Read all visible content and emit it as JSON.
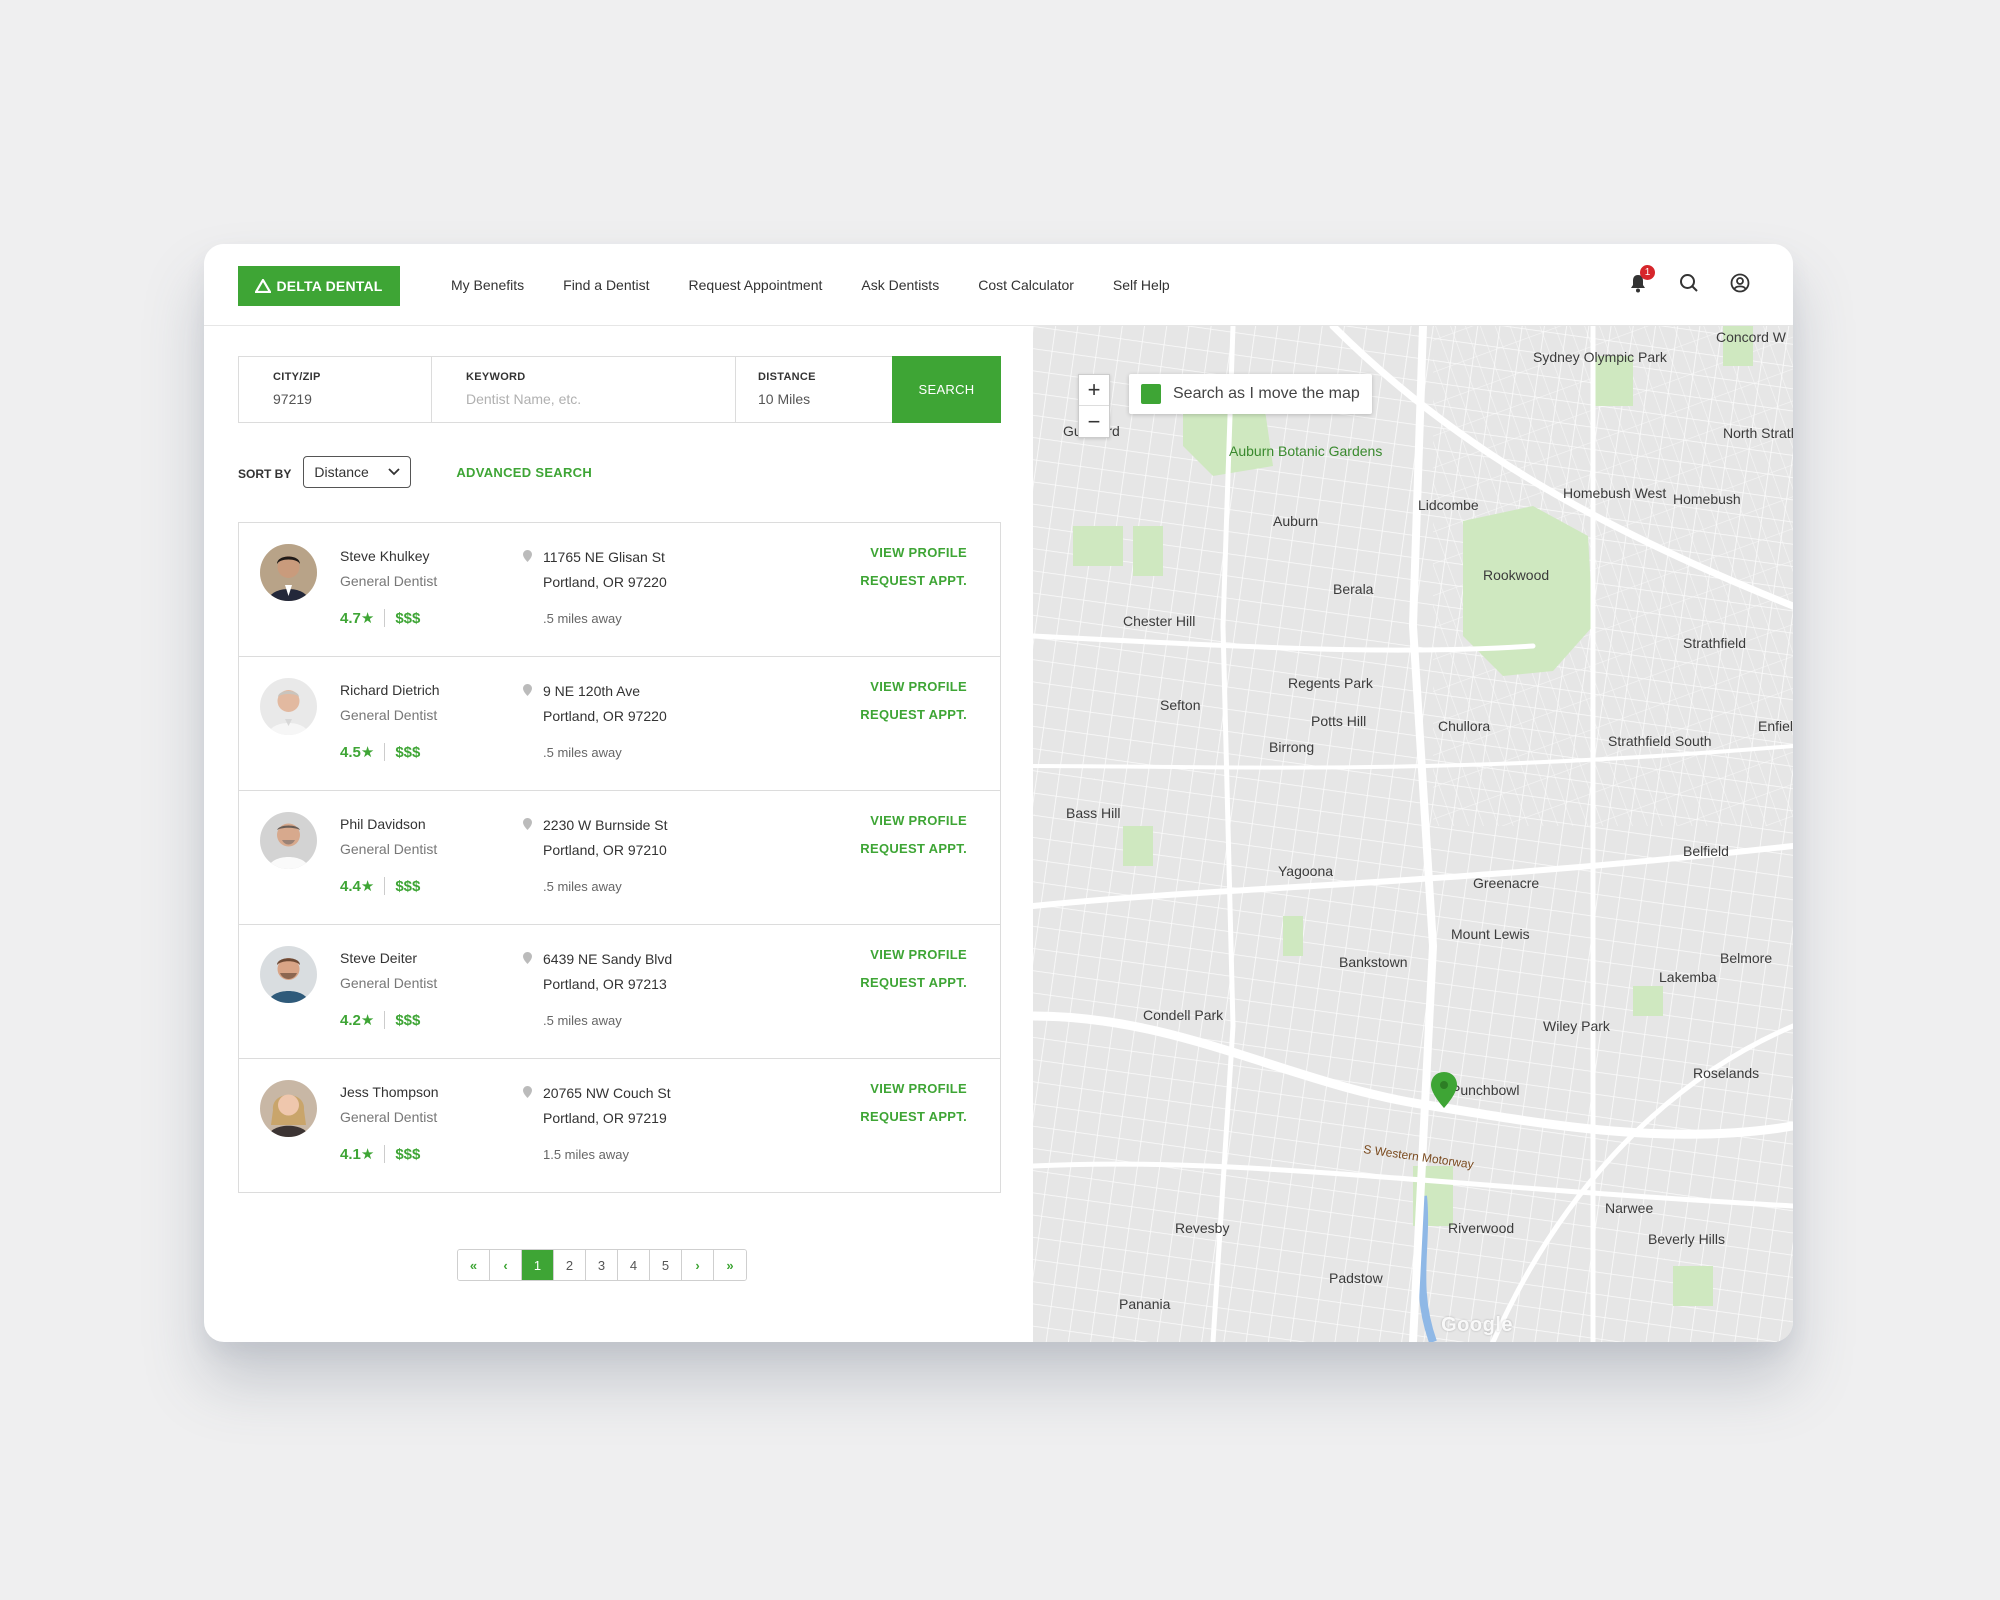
{
  "brand": {
    "logo_text": "DELTA DENTAL",
    "accent": "#3ea535"
  },
  "nav": [
    "My Benefits",
    "Find a Dentist",
    "Request Appointment",
    "Ask Dentists",
    "Cost Calculator",
    "Self Help"
  ],
  "header_icons": {
    "notifications": "bell-icon",
    "notification_count": "1",
    "search": "search-icon",
    "account": "user-icon"
  },
  "search": {
    "city_label": "CITY/ZIP",
    "city_value": "97219",
    "keyword_label": "KEYWORD",
    "keyword_placeholder": "Dentist Name, etc.",
    "distance_label": "DISTANCE",
    "distance_value": "10 Miles",
    "button": "SEARCH"
  },
  "sort": {
    "label": "SORT BY",
    "selected": "Distance",
    "advanced": "ADVANCED SEARCH"
  },
  "dentists": [
    {
      "name": "Steve Khulkey",
      "specialty": "General Dentist",
      "rating": "4.7",
      "cost": "$$$",
      "address1": "11765 NE Glisan St",
      "address2": "Portland, OR 97220",
      "distance": ".5 miles away",
      "view": "VIEW PROFILE",
      "request": "REQUEST APPT."
    },
    {
      "name": "Richard Dietrich",
      "specialty": "General Dentist",
      "rating": "4.5",
      "cost": "$$$",
      "address1": "9 NE 120th Ave",
      "address2": "Portland, OR 97220",
      "distance": ".5 miles away",
      "view": "VIEW PROFILE",
      "request": "REQUEST APPT."
    },
    {
      "name": "Phil Davidson",
      "specialty": "General Dentist",
      "rating": "4.4",
      "cost": "$$$",
      "address1": "2230 W Burnside St",
      "address2": "Portland, OR 97210",
      "distance": ".5 miles away",
      "view": "VIEW PROFILE",
      "request": "REQUEST APPT."
    },
    {
      "name": "Steve Deiter",
      "specialty": "General Dentist",
      "rating": "4.2",
      "cost": "$$$",
      "address1": "6439 NE Sandy Blvd",
      "address2": "Portland, OR 97213",
      "distance": ".5 miles away",
      "view": "VIEW PROFILE",
      "request": "REQUEST APPT."
    },
    {
      "name": "Jess Thompson",
      "specialty": "General Dentist",
      "rating": "4.1",
      "cost": "$$$",
      "address1": "20765 NW Couch St",
      "address2": "Portland, OR 97219",
      "distance": "1.5 miles away",
      "view": "VIEW PROFILE",
      "request": "REQUEST APPT."
    }
  ],
  "pagination": {
    "first": "«",
    "prev": "‹",
    "pages": [
      "1",
      "2",
      "3",
      "4",
      "5"
    ],
    "current": "1",
    "next": "›",
    "last": "»"
  },
  "map": {
    "zoom_in": "+",
    "zoom_out": "−",
    "search_toggle": "Search as I move the map",
    "attribution": "Google",
    "places": [
      "Concord W",
      "Sydney Olympic Park",
      "North Strathfield",
      "Homebush West",
      "Homebush",
      "Guildford",
      "Auburn Botanic Gardens",
      "Auburn",
      "Lidcombe",
      "Rookwood",
      "Berala",
      "Chester Hill",
      "Strathfield",
      "Regents Park",
      "Sefton",
      "Potts Hill",
      "Chullora",
      "Birrong",
      "Strathfield South",
      "Enfield",
      "Bass Hill",
      "Yagoona",
      "Greenacre",
      "Belfield",
      "Mount Lewis",
      "Bankstown",
      "Belmore",
      "Lakemba",
      "Condell Park",
      "Wiley Park",
      "Punchbowl",
      "Roselands",
      "Narwee",
      "Revesby",
      "Riverwood",
      "Beverly Hills",
      "Padstow",
      "Panania",
      "S Western Motorway"
    ]
  }
}
